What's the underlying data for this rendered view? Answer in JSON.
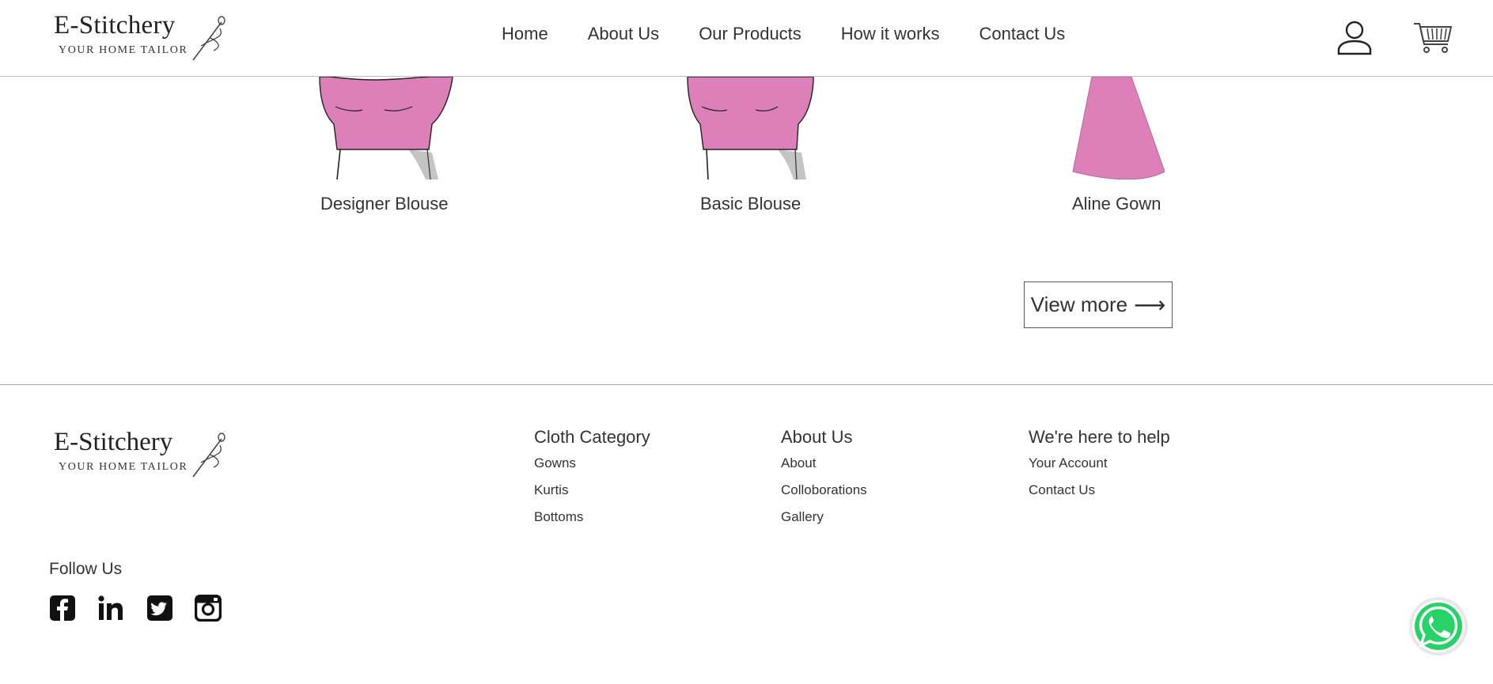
{
  "header": {
    "brand": "E-Stitchery",
    "tagline": "YOUR HOME TAILOR",
    "nav": [
      "Home",
      "About Us",
      "Our Products",
      "How it works",
      "Contact Us"
    ]
  },
  "products": [
    {
      "name": "Designer Blouse"
    },
    {
      "name": "Basic Blouse"
    },
    {
      "name": "Aline Gown"
    }
  ],
  "view_more": "View more",
  "footer": {
    "brand": "E-Stitchery",
    "tagline": "YOUR HOME TAILOR",
    "columns": [
      {
        "title": "Cloth Category",
        "links": [
          "Gowns",
          "Kurtis",
          "Bottoms"
        ]
      },
      {
        "title": "About Us",
        "links": [
          "About",
          "Colloborations",
          "Gallery"
        ]
      },
      {
        "title": "We're here to help",
        "links": [
          "Your Account",
          "Contact Us"
        ]
      }
    ],
    "follow_label": "Follow Us",
    "social": [
      "facebook-icon",
      "linkedin-icon",
      "twitter-icon",
      "instagram-icon"
    ]
  },
  "colors": {
    "garment": "#dd7fb8",
    "whatsapp": "#25d366"
  }
}
